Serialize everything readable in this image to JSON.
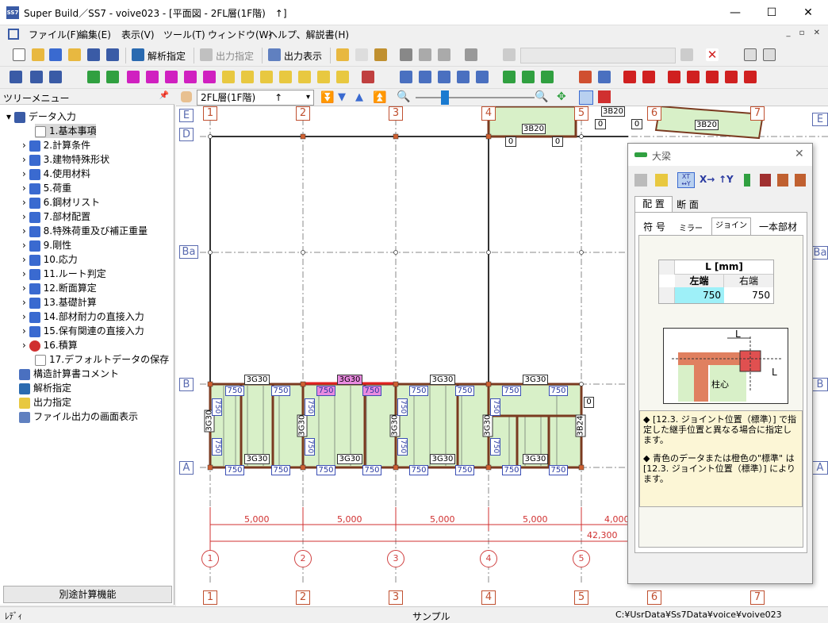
{
  "window": {
    "title": "Super Build／SS7 - voive023 - [平面図 - 2FL層(1F階)　↑]",
    "app_icon": "SS7"
  },
  "menus": [
    "ファイル(F)",
    "編集(E)",
    "表示(V)",
    "ツール(T)",
    "ウィンドウ(W)",
    "ヘルプ、解説書(H)"
  ],
  "toolbar": {
    "analysis": "解析指定",
    "output_spec": "出力指定",
    "output_show": "出力表示"
  },
  "tree": {
    "header": "ツリーメニュー",
    "root": "データ入力",
    "items": [
      "1.基本事項",
      "2.計算条件",
      "3.建物特殊形状",
      "4.使用材料",
      "5.荷重",
      "6.鋼材リスト",
      "7.部材配置",
      "8.特殊荷重及び補正重量",
      "9.剛性",
      "10.応力",
      "11.ルート判定",
      "12.断面算定",
      "13.基礎計算",
      "14.部材耐力の直接入力",
      "15.保有関連の直接入力",
      "16.積算",
      "17.デフォルトデータの保存"
    ],
    "others": [
      "構造計算書コメント",
      "解析指定",
      "出力指定",
      "ファイル出力の画面表示"
    ],
    "button": "別途計算機能"
  },
  "canvas": {
    "floor": "2FL層(1F階)",
    "floor_arrow": "↑",
    "rows": [
      "E",
      "D",
      "Ba",
      "B",
      "A"
    ],
    "cols": [
      "1",
      "2",
      "3",
      "4",
      "5",
      "6",
      "7"
    ],
    "beam_labels": {
      "top_a": "3B20",
      "top_b": "3B20",
      "top_c": "3B20",
      "g": "3G30",
      "gp": "3G30",
      "b24": "3B24"
    },
    "joint": "750",
    "zero": "0",
    "spans": [
      "5,000",
      "5,000",
      "5,000",
      "5,000",
      "4,000"
    ],
    "total": "42,300"
  },
  "dialog": {
    "title": "大梁",
    "tabs_top": [
      "配 置",
      "断 面"
    ],
    "tabs_sub": [
      "符 号",
      "ミラー",
      "ジョイント",
      "一本部材"
    ],
    "table": {
      "header": "L [mm]",
      "left": "左端",
      "right": "右端",
      "left_val": "750",
      "right_val": "750"
    },
    "diagram_label": "柱心",
    "diagram_L": "L",
    "note1": "◆ [12.3. ジョイント位置（標準）] で指定した継手位置と異なる場合に指定します。",
    "note2": "◆ 青色のデータまたは橙色の\"標準\" は [12.3. ジョイント位置（標準）] によります。"
  },
  "status": {
    "left": "ﾚﾃﾞｨ",
    "center": "サンプル",
    "path": "C:¥UsrData¥Ss7Data¥voice¥voive023"
  }
}
